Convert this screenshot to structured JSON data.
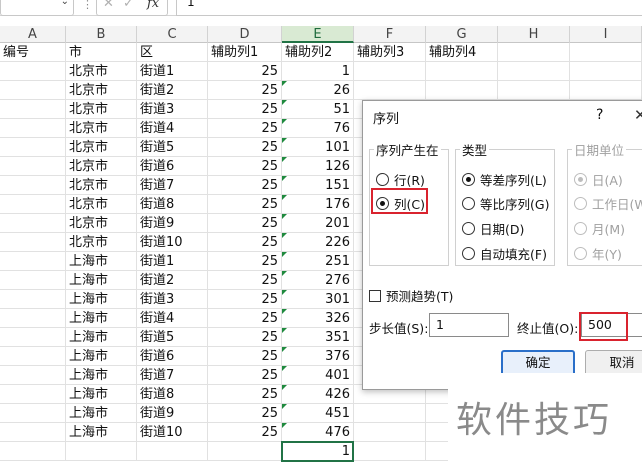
{
  "formula_bar": {
    "name_box_value": "",
    "cancel_symbol": "✕",
    "enter_symbol": "✓",
    "fx_label": "fx",
    "formula_value": "1"
  },
  "columns": [
    "A",
    "B",
    "C",
    "D",
    "E",
    "F",
    "G",
    "H",
    "I"
  ],
  "selected_column": "E",
  "header_row": {
    "A": "编号",
    "B": "市",
    "C": "区",
    "D": "辅助列1",
    "E": "辅助列2",
    "F": "辅助列3",
    "G": "辅助列4"
  },
  "rows": [
    {
      "city": "北京市",
      "district": "街道1",
      "aux1": "25",
      "aux2": "1"
    },
    {
      "city": "北京市",
      "district": "街道2",
      "aux1": "25",
      "aux2": "26"
    },
    {
      "city": "北京市",
      "district": "街道3",
      "aux1": "25",
      "aux2": "51"
    },
    {
      "city": "北京市",
      "district": "街道4",
      "aux1": "25",
      "aux2": "76"
    },
    {
      "city": "北京市",
      "district": "街道5",
      "aux1": "25",
      "aux2": "101"
    },
    {
      "city": "北京市",
      "district": "街道6",
      "aux1": "25",
      "aux2": "126"
    },
    {
      "city": "北京市",
      "district": "街道7",
      "aux1": "25",
      "aux2": "151"
    },
    {
      "city": "北京市",
      "district": "街道8",
      "aux1": "25",
      "aux2": "176"
    },
    {
      "city": "北京市",
      "district": "街道9",
      "aux1": "25",
      "aux2": "201"
    },
    {
      "city": "北京市",
      "district": "街道10",
      "aux1": "25",
      "aux2": "226"
    },
    {
      "city": "上海市",
      "district": "街道1",
      "aux1": "25",
      "aux2": "251"
    },
    {
      "city": "上海市",
      "district": "街道2",
      "aux1": "25",
      "aux2": "276"
    },
    {
      "city": "上海市",
      "district": "街道3",
      "aux1": "25",
      "aux2": "301"
    },
    {
      "city": "上海市",
      "district": "街道4",
      "aux1": "25",
      "aux2": "326"
    },
    {
      "city": "上海市",
      "district": "街道5",
      "aux1": "25",
      "aux2": "351"
    },
    {
      "city": "上海市",
      "district": "街道6",
      "aux1": "25",
      "aux2": "376"
    },
    {
      "city": "上海市",
      "district": "街道7",
      "aux1": "25",
      "aux2": "401"
    },
    {
      "city": "上海市",
      "district": "街道8",
      "aux1": "25",
      "aux2": "426"
    },
    {
      "city": "上海市",
      "district": "街道9",
      "aux1": "25",
      "aux2": "451"
    },
    {
      "city": "上海市",
      "district": "街道10",
      "aux1": "25",
      "aux2": "476"
    },
    {
      "city": "",
      "district": "",
      "aux1": "",
      "aux2": "1"
    }
  ],
  "dialog": {
    "title": "序列",
    "help": "?",
    "close": "✕",
    "series_in": {
      "label": "序列产生在",
      "rows_option": "行(R)",
      "columns_option": "列(C)",
      "selected": "columns"
    },
    "type": {
      "label": "类型",
      "options": [
        "等差序列(L)",
        "等比序列(G)",
        "日期(D)",
        "自动填充(F)"
      ],
      "selected": "等差序列(L)"
    },
    "date_unit": {
      "label": "日期单位",
      "options": [
        "日(A)",
        "工作日(W)",
        "月(M)",
        "年(Y)"
      ],
      "selected": "日(A)",
      "disabled": true
    },
    "trend_checkbox": {
      "label": "预测趋势(T)",
      "checked": false
    },
    "step_label": "步长值(S):",
    "step_value": "1",
    "stop_label": "终止值(O):",
    "stop_value": "500",
    "ok_label": "确定",
    "cancel_label": "取消"
  },
  "watermark": "软件技巧",
  "colors": {
    "highlight": "#d9232e",
    "selection": "#217346",
    "default_button": "#2a6fc9"
  }
}
